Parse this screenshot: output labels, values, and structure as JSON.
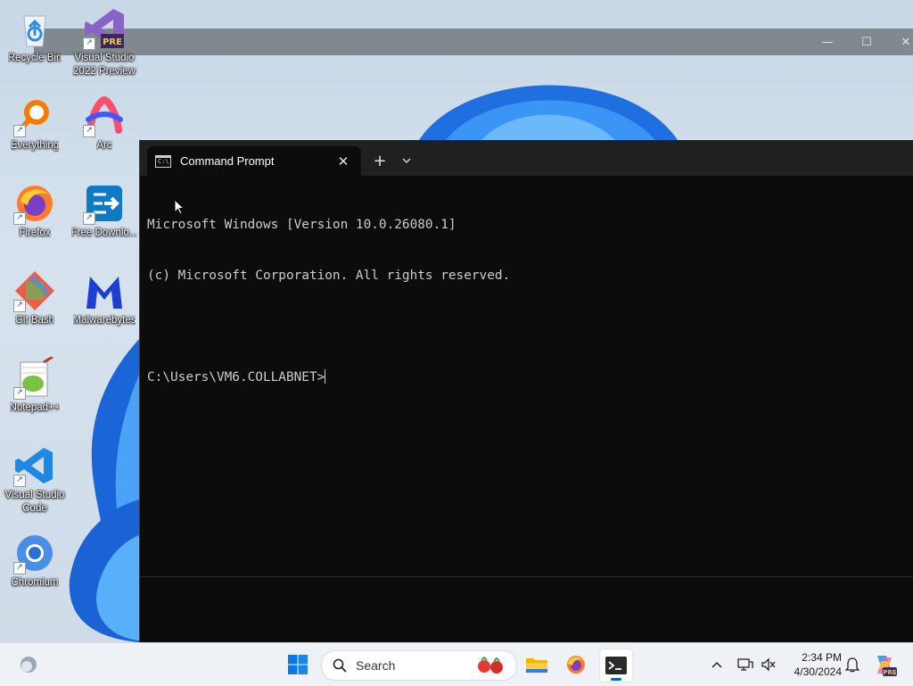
{
  "desktop": {
    "icons": [
      {
        "label": "Recycle Bin"
      },
      {
        "label": "Visual Studio 2022 Preview"
      },
      {
        "label": "Everything"
      },
      {
        "label": "Arc"
      },
      {
        "label": "Firefox"
      },
      {
        "label": "Free Downlo..."
      },
      {
        "label": "Git Bash"
      },
      {
        "label": "Malwarebytes"
      },
      {
        "label": "Notepad++"
      },
      {
        "label": "Visual Studio Code"
      },
      {
        "label": "Chromium"
      }
    ],
    "vs_badge": "PRE"
  },
  "terminal": {
    "tab_title": "Command Prompt",
    "tab_icon_text": "C:\\",
    "lines": [
      "Microsoft Windows [Version 10.0.26080.1]",
      "(c) Microsoft Corporation. All rights reserved.",
      "",
      "C:\\Users\\VM6.COLLABNET>"
    ]
  },
  "taskbar": {
    "search_placeholder": "Search",
    "clock_time": "2:34 PM",
    "clock_date": "4/30/2024",
    "copilot_badge": "PRE"
  },
  "colors": {
    "accent": "#0067c0",
    "terminal_bg": "#0c0c0c",
    "titlebar_bg": "#202020",
    "console_text": "#cccccc"
  }
}
